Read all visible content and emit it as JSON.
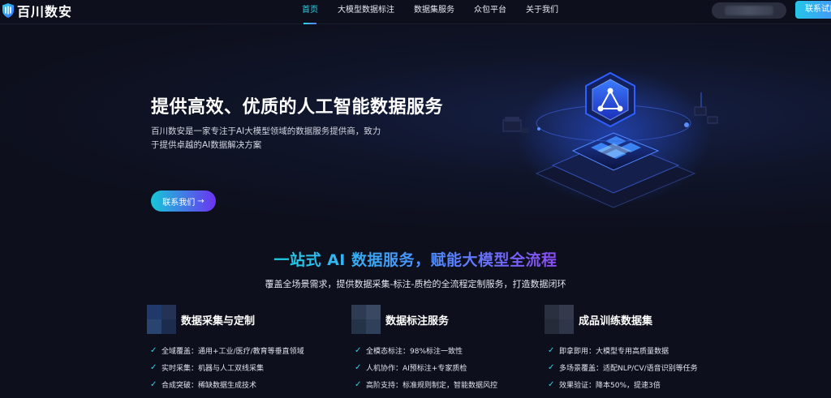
{
  "nav": {
    "brand": "百川数安",
    "links": [
      {
        "label": "首页",
        "active": true
      },
      {
        "label": "大模型数据标注",
        "active": false
      },
      {
        "label": "数据集服务",
        "active": false
      },
      {
        "label": "众包平台",
        "active": false
      },
      {
        "label": "关于我们",
        "active": false
      }
    ],
    "cta_label": "联系试用"
  },
  "hero": {
    "title": "提供高效、优质的人工智能数据服务",
    "desc_line1": "百川数安是一家专注于AI大模型领域的数据服务提供商，致力",
    "desc_line2": "于提供卓越的AI数据解决方案",
    "button_label": "联系我们",
    "button_arrow": "→"
  },
  "section": {
    "title": "一站式 AI 数据服务，赋能大模型全流程",
    "subtitle": "覆盖全场景需求，提供数据采集-标注-质检的全流程定制服务，打造数据闭环"
  },
  "cards": [
    {
      "title": "数据采集与定制",
      "items": [
        "全域覆盖：通用+工业/医疗/教育等垂直领域",
        "实时采集：机器与人工双线采集",
        "合成突破：稀缺数据生成技术"
      ]
    },
    {
      "title": "数据标注服务",
      "items": [
        "全模态标注：98%标注一致性",
        "人机协作：AI预标注+专家质检",
        "高阶支持：标准规则制定，智能数据风控"
      ]
    },
    {
      "title": "成品训练数据集",
      "items": [
        "即拿即用：大模型专用高质量数据",
        "多场景覆盖：适配NLP/CV/语音识别等任务",
        "效果验证：降本50%，提速3倍"
      ]
    }
  ],
  "colors": {
    "background": "#0d0f1c",
    "accent_cyan": "#2cd7e6",
    "accent_blue": "#4e8dff",
    "accent_purple": "#8b4bf2"
  },
  "icons": {
    "logo": "shield-logo-icon",
    "check": "check-icon",
    "arrow": "arrow-right-icon"
  }
}
